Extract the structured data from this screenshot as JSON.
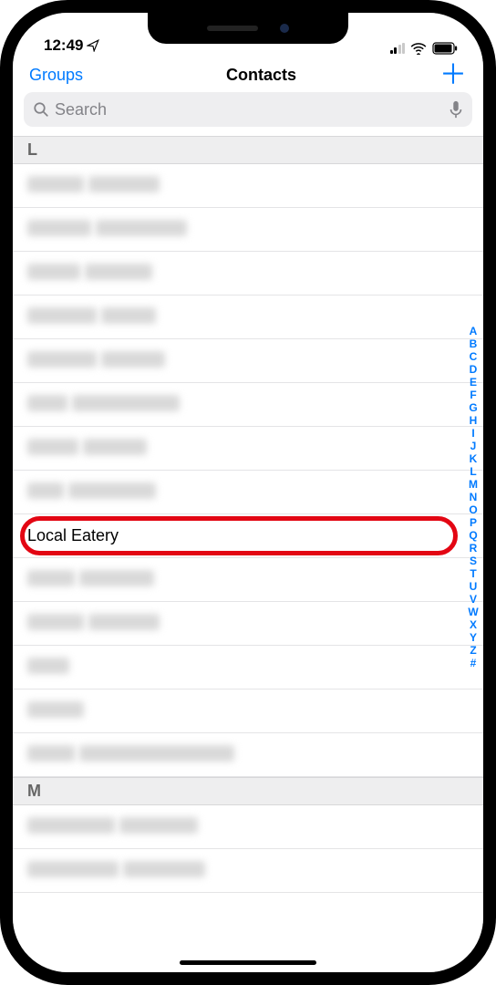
{
  "status": {
    "time": "12:49"
  },
  "nav": {
    "left": "Groups",
    "title": "Contacts",
    "add": "＋"
  },
  "search": {
    "placeholder": "Search"
  },
  "sections": {
    "L": "L",
    "M": "M"
  },
  "rows": {
    "highlight": "Local Eatery"
  },
  "blurred_L": [
    {
      "w1": 62,
      "w2": 78
    },
    {
      "w1": 70,
      "w2": 100
    },
    {
      "w1": 58,
      "w2": 74
    },
    {
      "w1": 76,
      "w2": 60
    },
    {
      "w1": 76,
      "w2": 70
    },
    {
      "w1": 44,
      "w2": 118
    },
    {
      "w1": 56,
      "w2": 70
    },
    {
      "w1": 40,
      "w2": 96
    }
  ],
  "blurred_after": [
    {
      "w1": 52,
      "w2": 82
    },
    {
      "w1": 62,
      "w2": 78
    },
    {
      "w1": 46,
      "w2": 0
    },
    {
      "w1": 62,
      "w2": 0
    },
    {
      "w1": 52,
      "w2": 170
    }
  ],
  "blurred_M": [
    {
      "w1": 96,
      "w2": 86
    },
    {
      "w1": 100,
      "w2": 90
    }
  ],
  "index": [
    "A",
    "B",
    "C",
    "D",
    "E",
    "F",
    "G",
    "H",
    "I",
    "J",
    "K",
    "L",
    "M",
    "N",
    "O",
    "P",
    "Q",
    "R",
    "S",
    "T",
    "U",
    "V",
    "W",
    "X",
    "Y",
    "Z",
    "#"
  ]
}
